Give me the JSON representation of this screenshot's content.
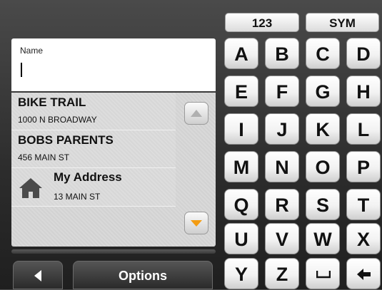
{
  "name_field": {
    "label": "Name",
    "value": ""
  },
  "results": [
    {
      "title": "BIKE TRAIL",
      "subtitle": "1000 N BROADWAY"
    },
    {
      "title": "BOBS PARENTS",
      "subtitle": "456 MAIN ST"
    },
    {
      "title": "My Address",
      "subtitle": "13 MAIN ST",
      "icon": "home-icon"
    }
  ],
  "scroll": {
    "up_icon": "arrow-up-icon",
    "down_icon": "arrow-down-icon"
  },
  "bottom_bar": {
    "back_icon": "back-arrow-icon",
    "options_label": "Options"
  },
  "keyboard": {
    "modes": [
      "123",
      "SYM"
    ],
    "letters": [
      "A",
      "B",
      "C",
      "D",
      "E",
      "F",
      "G",
      "H",
      "I",
      "J",
      "K",
      "L",
      "M",
      "N",
      "O",
      "P",
      "Q",
      "R",
      "S",
      "T",
      "U",
      "V",
      "W",
      "X",
      "Y",
      "Z"
    ],
    "space_icon": "space-icon",
    "backspace_icon": "backspace-arrow-icon"
  },
  "colors": {
    "scroll_down_arrow": "#f39c12",
    "scroll_up_arrow": "#b0b0b0"
  }
}
